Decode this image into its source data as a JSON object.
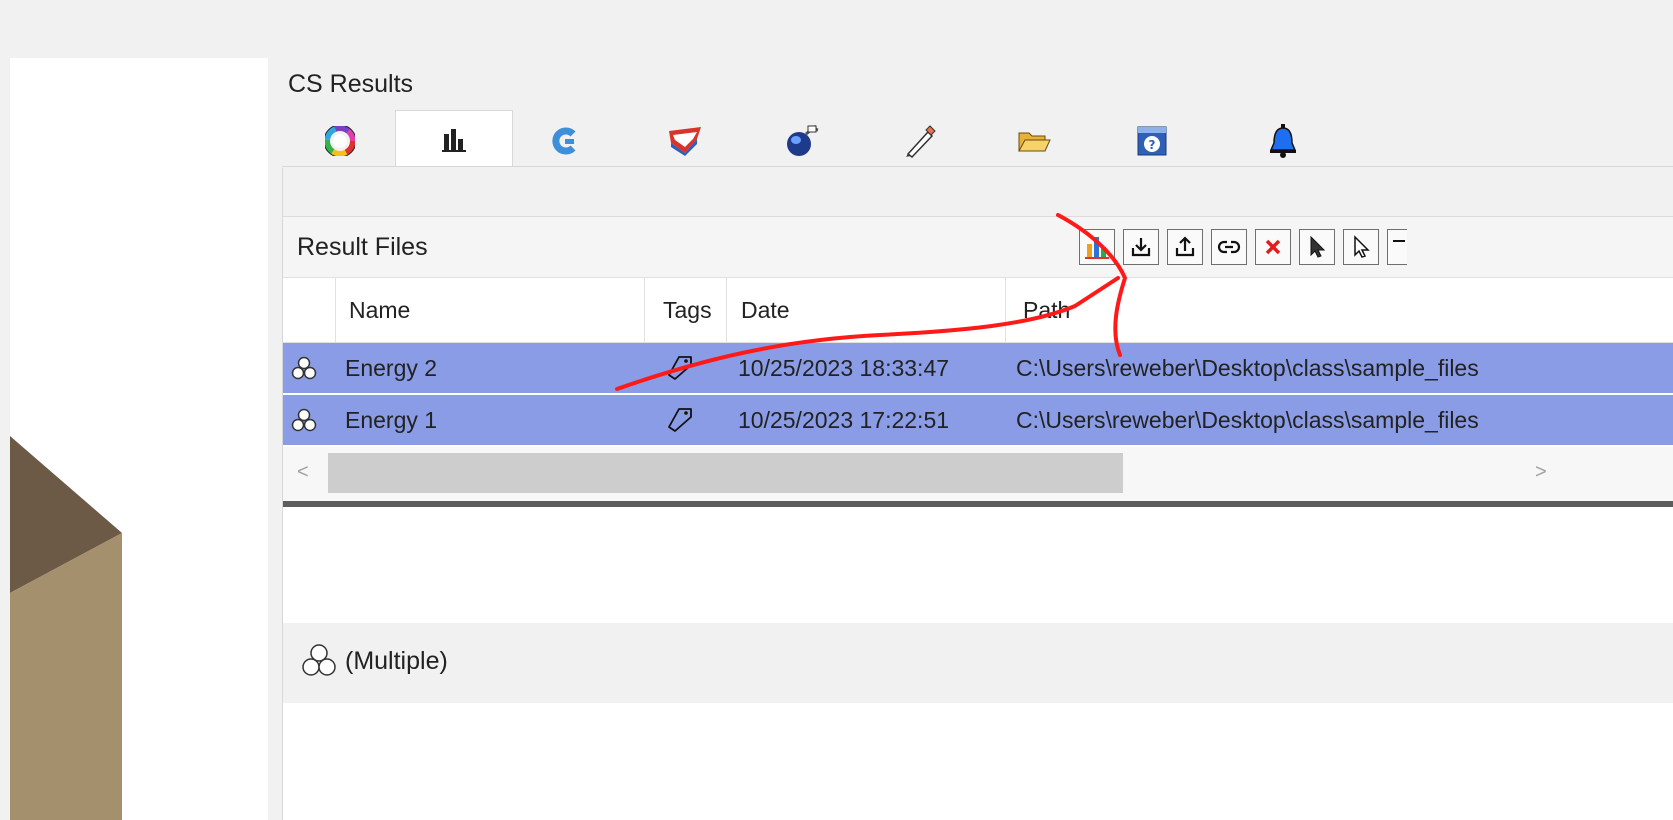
{
  "panel": {
    "title": "CS Results"
  },
  "tabs": [
    {
      "icon": "color-wheel-icon",
      "active": false
    },
    {
      "icon": "bar-chart-icon",
      "active": true
    },
    {
      "icon": "blue-c-icon",
      "active": false
    },
    {
      "icon": "layers-icon",
      "active": false
    },
    {
      "icon": "globe-icon",
      "active": false
    },
    {
      "icon": "pen-icon",
      "active": false
    },
    {
      "icon": "folder-icon",
      "active": false
    },
    {
      "icon": "help-window-icon",
      "active": false
    },
    {
      "icon": "bell-icon",
      "active": false
    }
  ],
  "result_files": {
    "title": "Result Files",
    "toolbar": [
      "chart-button",
      "import-button",
      "export-button",
      "link-button",
      "delete-button",
      "select-button",
      "deselect-button"
    ]
  },
  "table": {
    "headers": {
      "name": "Name",
      "tags": "Tags",
      "date": "Date",
      "path": "Path"
    },
    "rows": [
      {
        "name": "Energy 2",
        "date": "10/25/2023 18:33:47",
        "path": "C:\\Users\\reweber\\Desktop\\class\\sample_files"
      },
      {
        "name": "Energy 1",
        "date": "10/25/2023 17:22:51",
        "path": "C:\\Users\\reweber\\Desktop\\class\\sample_files"
      }
    ]
  },
  "scroll": {
    "left_arrow": "<",
    "right_arrow": ">"
  },
  "detail": {
    "label": "(Multiple)"
  },
  "colors": {
    "selection": "#8a9ce6",
    "annotation": "#ff1a1a",
    "panel": "#f1f1f1"
  }
}
